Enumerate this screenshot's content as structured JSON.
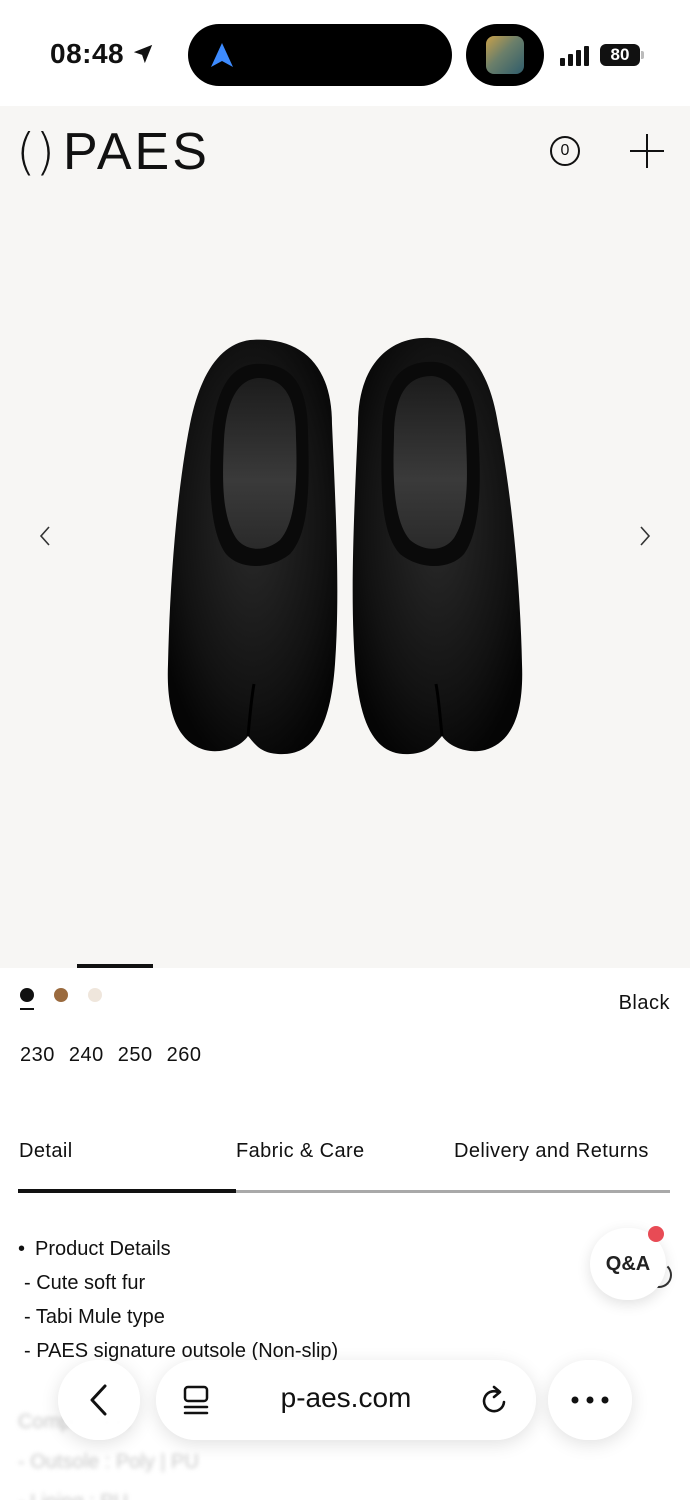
{
  "status_bar": {
    "time": "08:48",
    "battery": "80"
  },
  "header": {
    "logo_mark": "()",
    "logo_text": "PAES",
    "cart_count": "0"
  },
  "product": {
    "color_selected": "Black",
    "swatches": [
      {
        "name": "Black",
        "color": "#111111"
      },
      {
        "name": "Brown",
        "color": "#9a6a3e"
      },
      {
        "name": "Cream",
        "color": "#efe6dc"
      }
    ],
    "sizes": [
      "230",
      "240",
      "250",
      "260"
    ]
  },
  "tabs": [
    {
      "label": "Detail"
    },
    {
      "label": "Fabric & Care"
    },
    {
      "label": "Delivery and Returns"
    }
  ],
  "details": {
    "heading": "Product Details",
    "items": [
      "- Cute soft fur",
      "- Tabi Mule type",
      "- PAES signature outsole (Non-slip)"
    ],
    "blurred": [
      "Composition",
      "- Outsole : Poly | PU",
      "- Lining : PU"
    ]
  },
  "qa": {
    "label": "Q&A"
  },
  "browser": {
    "url": "p-aes.com"
  }
}
